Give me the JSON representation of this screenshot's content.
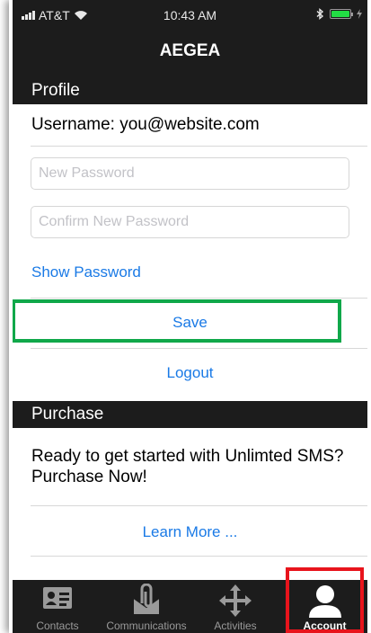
{
  "status_bar": {
    "carrier": "AT&T",
    "time": "10:43 AM"
  },
  "nav": {
    "title": "AEGEA"
  },
  "profile": {
    "header": "Profile",
    "username": "Username: you@website.com",
    "new_password_placeholder": "New Password",
    "confirm_password_placeholder": "Confirm New Password",
    "show_password": "Show Password",
    "save": "Save",
    "logout": "Logout"
  },
  "purchase": {
    "header": "Purchase",
    "promo": "Ready to get started with Unlimted SMS? Purchase Now!",
    "learn_more": "Learn More ..."
  },
  "tabs": [
    {
      "label": "Contacts",
      "icon": "contact-card-icon"
    },
    {
      "label": "Communications",
      "icon": "paperclip-envelope-icon"
    },
    {
      "label": "Activities",
      "icon": "move-arrows-icon"
    },
    {
      "label": "Account",
      "icon": "person-icon"
    }
  ],
  "colors": {
    "bar_background": "#1c1c1c",
    "link": "#1a7ae6",
    "save_highlight": "#10a84a",
    "account_highlight": "#e8141c",
    "battery": "#22dd44"
  }
}
